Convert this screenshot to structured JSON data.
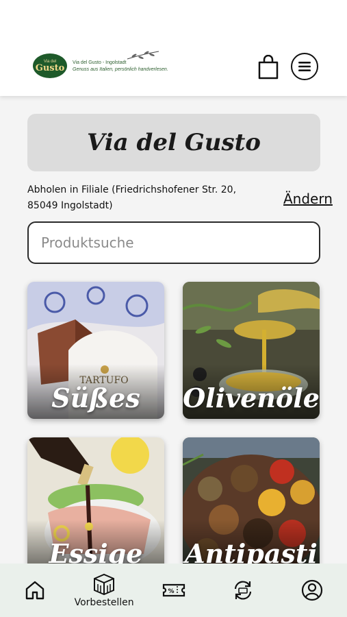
{
  "header": {
    "logo": {
      "badge_top": "Via del",
      "badge_main": "Gusto",
      "line1": "Via del Gusto - Ingolstadt",
      "line2": "Genuss aus Italien, persönlich handverlesen."
    },
    "cart_icon": "shopping-bag-icon",
    "menu_icon": "hamburger-menu-icon"
  },
  "banner": {
    "title": "Via del Gusto"
  },
  "pickup": {
    "text": "Abholen in Filiale (Friedrichshofener Str. 20, 85049 Ingolstadt)",
    "change_label": "Ändern"
  },
  "search": {
    "placeholder": "Produktsuche",
    "value": ""
  },
  "categories": [
    {
      "label": "Süßes"
    },
    {
      "label": "Olivenöle"
    },
    {
      "label": "Essige"
    },
    {
      "label": "Antipasti"
    }
  ],
  "bottom_nav": {
    "items": [
      {
        "icon": "home-icon",
        "label": ""
      },
      {
        "icon": "box-icon",
        "label": "Vorbestellen"
      },
      {
        "icon": "coupon-icon",
        "label": ""
      },
      {
        "icon": "refresh-icon",
        "label": ""
      },
      {
        "icon": "user-icon",
        "label": ""
      }
    ]
  },
  "colors": {
    "accent": "#1e5a2a",
    "nav_bg": "#eaf0eb",
    "banner_bg": "#dcdcdc"
  }
}
